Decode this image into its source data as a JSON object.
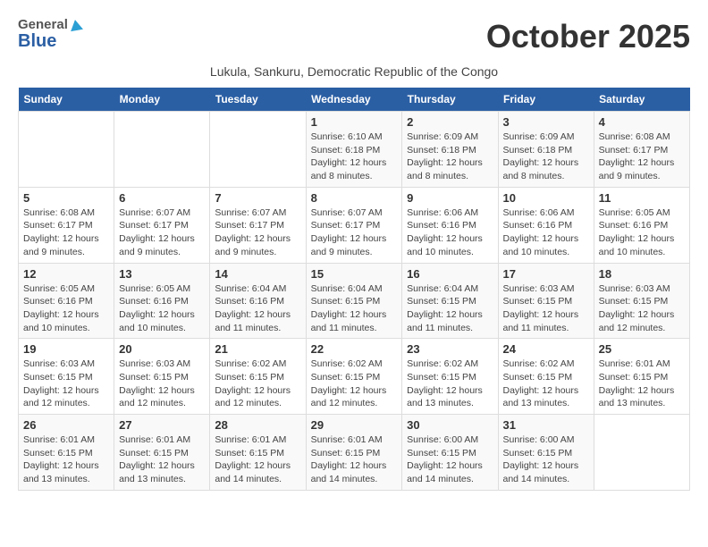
{
  "header": {
    "logo_general": "General",
    "logo_blue": "Blue",
    "month_title": "October 2025",
    "subtitle": "Lukula, Sankuru, Democratic Republic of the Congo"
  },
  "days_of_week": [
    "Sunday",
    "Monday",
    "Tuesday",
    "Wednesday",
    "Thursday",
    "Friday",
    "Saturday"
  ],
  "weeks": [
    [
      {
        "num": "",
        "info": ""
      },
      {
        "num": "",
        "info": ""
      },
      {
        "num": "",
        "info": ""
      },
      {
        "num": "1",
        "info": "Sunrise: 6:10 AM\nSunset: 6:18 PM\nDaylight: 12 hours\nand 8 minutes."
      },
      {
        "num": "2",
        "info": "Sunrise: 6:09 AM\nSunset: 6:18 PM\nDaylight: 12 hours\nand 8 minutes."
      },
      {
        "num": "3",
        "info": "Sunrise: 6:09 AM\nSunset: 6:18 PM\nDaylight: 12 hours\nand 8 minutes."
      },
      {
        "num": "4",
        "info": "Sunrise: 6:08 AM\nSunset: 6:17 PM\nDaylight: 12 hours\nand 9 minutes."
      }
    ],
    [
      {
        "num": "5",
        "info": "Sunrise: 6:08 AM\nSunset: 6:17 PM\nDaylight: 12 hours\nand 9 minutes."
      },
      {
        "num": "6",
        "info": "Sunrise: 6:07 AM\nSunset: 6:17 PM\nDaylight: 12 hours\nand 9 minutes."
      },
      {
        "num": "7",
        "info": "Sunrise: 6:07 AM\nSunset: 6:17 PM\nDaylight: 12 hours\nand 9 minutes."
      },
      {
        "num": "8",
        "info": "Sunrise: 6:07 AM\nSunset: 6:17 PM\nDaylight: 12 hours\nand 9 minutes."
      },
      {
        "num": "9",
        "info": "Sunrise: 6:06 AM\nSunset: 6:16 PM\nDaylight: 12 hours\nand 10 minutes."
      },
      {
        "num": "10",
        "info": "Sunrise: 6:06 AM\nSunset: 6:16 PM\nDaylight: 12 hours\nand 10 minutes."
      },
      {
        "num": "11",
        "info": "Sunrise: 6:05 AM\nSunset: 6:16 PM\nDaylight: 12 hours\nand 10 minutes."
      }
    ],
    [
      {
        "num": "12",
        "info": "Sunrise: 6:05 AM\nSunset: 6:16 PM\nDaylight: 12 hours\nand 10 minutes."
      },
      {
        "num": "13",
        "info": "Sunrise: 6:05 AM\nSunset: 6:16 PM\nDaylight: 12 hours\nand 10 minutes."
      },
      {
        "num": "14",
        "info": "Sunrise: 6:04 AM\nSunset: 6:16 PM\nDaylight: 12 hours\nand 11 minutes."
      },
      {
        "num": "15",
        "info": "Sunrise: 6:04 AM\nSunset: 6:15 PM\nDaylight: 12 hours\nand 11 minutes."
      },
      {
        "num": "16",
        "info": "Sunrise: 6:04 AM\nSunset: 6:15 PM\nDaylight: 12 hours\nand 11 minutes."
      },
      {
        "num": "17",
        "info": "Sunrise: 6:03 AM\nSunset: 6:15 PM\nDaylight: 12 hours\nand 11 minutes."
      },
      {
        "num": "18",
        "info": "Sunrise: 6:03 AM\nSunset: 6:15 PM\nDaylight: 12 hours\nand 12 minutes."
      }
    ],
    [
      {
        "num": "19",
        "info": "Sunrise: 6:03 AM\nSunset: 6:15 PM\nDaylight: 12 hours\nand 12 minutes."
      },
      {
        "num": "20",
        "info": "Sunrise: 6:03 AM\nSunset: 6:15 PM\nDaylight: 12 hours\nand 12 minutes."
      },
      {
        "num": "21",
        "info": "Sunrise: 6:02 AM\nSunset: 6:15 PM\nDaylight: 12 hours\nand 12 minutes."
      },
      {
        "num": "22",
        "info": "Sunrise: 6:02 AM\nSunset: 6:15 PM\nDaylight: 12 hours\nand 12 minutes."
      },
      {
        "num": "23",
        "info": "Sunrise: 6:02 AM\nSunset: 6:15 PM\nDaylight: 12 hours\nand 13 minutes."
      },
      {
        "num": "24",
        "info": "Sunrise: 6:02 AM\nSunset: 6:15 PM\nDaylight: 12 hours\nand 13 minutes."
      },
      {
        "num": "25",
        "info": "Sunrise: 6:01 AM\nSunset: 6:15 PM\nDaylight: 12 hours\nand 13 minutes."
      }
    ],
    [
      {
        "num": "26",
        "info": "Sunrise: 6:01 AM\nSunset: 6:15 PM\nDaylight: 12 hours\nand 13 minutes."
      },
      {
        "num": "27",
        "info": "Sunrise: 6:01 AM\nSunset: 6:15 PM\nDaylight: 12 hours\nand 13 minutes."
      },
      {
        "num": "28",
        "info": "Sunrise: 6:01 AM\nSunset: 6:15 PM\nDaylight: 12 hours\nand 14 minutes."
      },
      {
        "num": "29",
        "info": "Sunrise: 6:01 AM\nSunset: 6:15 PM\nDaylight: 12 hours\nand 14 minutes."
      },
      {
        "num": "30",
        "info": "Sunrise: 6:00 AM\nSunset: 6:15 PM\nDaylight: 12 hours\nand 14 minutes."
      },
      {
        "num": "31",
        "info": "Sunrise: 6:00 AM\nSunset: 6:15 PM\nDaylight: 12 hours\nand 14 minutes."
      },
      {
        "num": "",
        "info": ""
      }
    ]
  ]
}
